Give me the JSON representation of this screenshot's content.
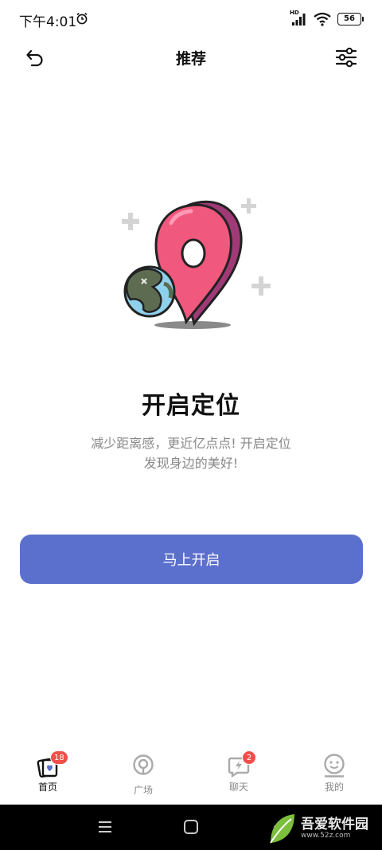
{
  "status_bar": {
    "time": "下午4:01",
    "network": "HD",
    "battery": "56",
    "icons": [
      "alarm-icon",
      "signal-icon",
      "wifi-icon",
      "battery-icon"
    ]
  },
  "header": {
    "title": "推荐",
    "left_icon": "back-icon",
    "right_icon": "filter-icon"
  },
  "main": {
    "illustration": "location-pin-with-globe",
    "title": "开启定位",
    "description_line1": "减少距离感，更近亿点点! 开启定位",
    "description_line2": "发现身边的美好!",
    "button_label": "马上开启"
  },
  "tabs": [
    {
      "label": "首页",
      "icon": "cards-icon",
      "badge": "18",
      "active": true
    },
    {
      "label": "广场",
      "icon": "location-icon",
      "active": false
    },
    {
      "label": "聊天",
      "icon": "chat-bolt-icon",
      "badge": "2",
      "active": false
    },
    {
      "label": "我的",
      "icon": "smiley-profile-icon",
      "active": false
    }
  ],
  "system_nav": {
    "icons": [
      "menu-icon",
      "home-icon",
      "back-icon"
    ]
  },
  "watermark": {
    "text": "吾爱软件园",
    "url": "www.52z.com"
  },
  "colors": {
    "accent": "#5b6fcd",
    "badge": "#f0504a",
    "pin": "#f0587e",
    "pin_shadow": "#b43c6a",
    "globe_water": "#8fd0ec",
    "globe_land": "#5d6b50"
  }
}
